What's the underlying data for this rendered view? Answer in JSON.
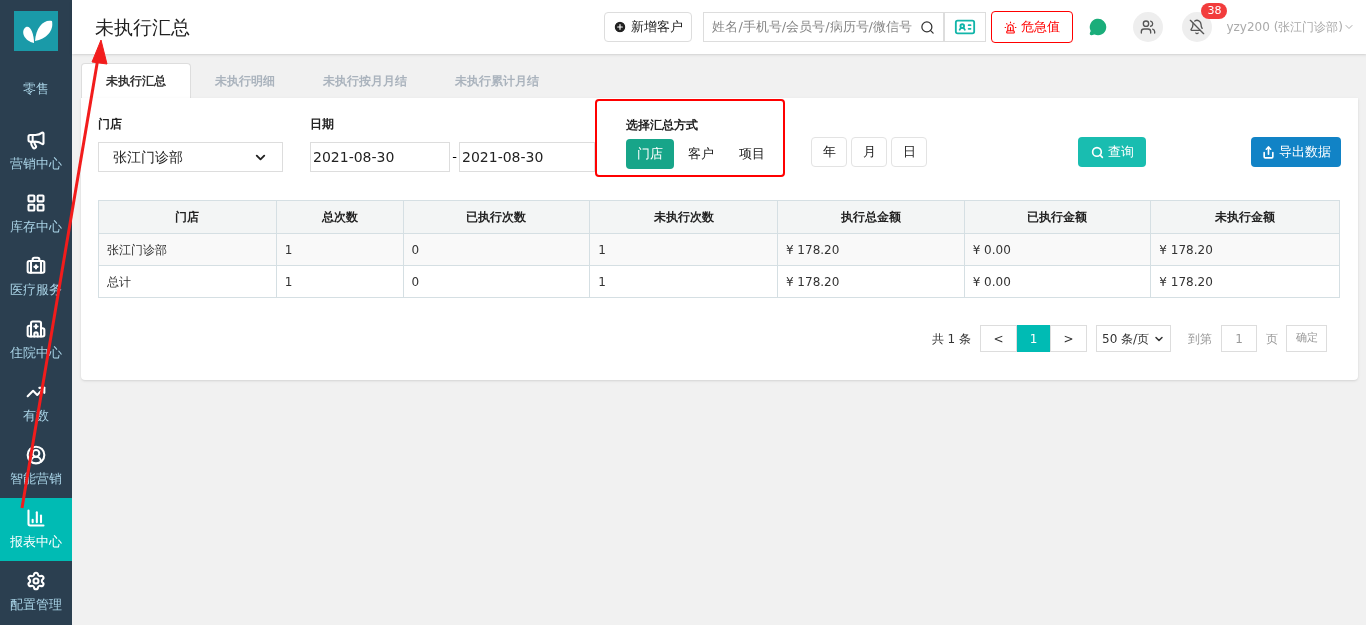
{
  "page_title": "未执行汇总",
  "header": {
    "add_customer": "新增客户",
    "search": {
      "placeholder": "姓名/手机号/会员号/病历号/微信号"
    },
    "alert_button": "危急值",
    "notification_count": "38",
    "user": "yzy200 (张江门诊部)"
  },
  "sidebar": {
    "items": [
      {
        "label": "零售",
        "selected": false
      },
      {
        "label": "营销中心",
        "selected": false
      },
      {
        "label": "库存中心",
        "selected": false
      },
      {
        "label": "医疗服务",
        "selected": false
      },
      {
        "label": "住院中心",
        "selected": false
      },
      {
        "label": "有数",
        "selected": false
      },
      {
        "label": "智能营销",
        "selected": false
      },
      {
        "label": "报表中心",
        "selected": true
      },
      {
        "label": "配置管理",
        "selected": false
      }
    ]
  },
  "tabs": [
    {
      "label": "未执行汇总",
      "selected": true
    },
    {
      "label": "未执行明细",
      "selected": false
    },
    {
      "label": "未执行按月月结",
      "selected": false
    },
    {
      "label": "未执行累计月结",
      "selected": false
    }
  ],
  "filters": {
    "store": {
      "label": "门店",
      "value": "张江门诊部"
    },
    "date": {
      "label": "日期",
      "from": "2021-08-30",
      "separator": "-",
      "to": "2021-08-30"
    },
    "summary_mode": {
      "label": "选择汇总方式",
      "options": [
        {
          "label": "门店",
          "selected": true
        },
        {
          "label": "客户",
          "selected": false
        },
        {
          "label": "项目",
          "selected": false
        }
      ]
    },
    "periods": [
      {
        "label": "年",
        "selected": false
      },
      {
        "label": "月",
        "selected": false
      },
      {
        "label": "日",
        "selected": false
      }
    ],
    "query_button": "查询",
    "export_button": "导出数据"
  },
  "table": {
    "columns": [
      "门店",
      "总次数",
      "已执行次数",
      "未执行次数",
      "执行总金额",
      "已执行金额",
      "未执行金额"
    ],
    "rows": [
      [
        "张江门诊部",
        "1",
        "0",
        "1",
        "¥ 178.20",
        "¥ 0.00",
        "¥ 178.20"
      ],
      [
        "总计",
        "1",
        "0",
        "1",
        "¥ 178.20",
        "¥ 0.00",
        "¥ 178.20"
      ]
    ]
  },
  "pagination": {
    "total": "共 1 条",
    "prev": "<",
    "pages": [
      {
        "label": "1",
        "selected": true
      }
    ],
    "next": ">",
    "page_size": "50 条/页",
    "goto_label": "到第",
    "goto_value": "1",
    "page_unit": "页",
    "confirm": "确定"
  }
}
